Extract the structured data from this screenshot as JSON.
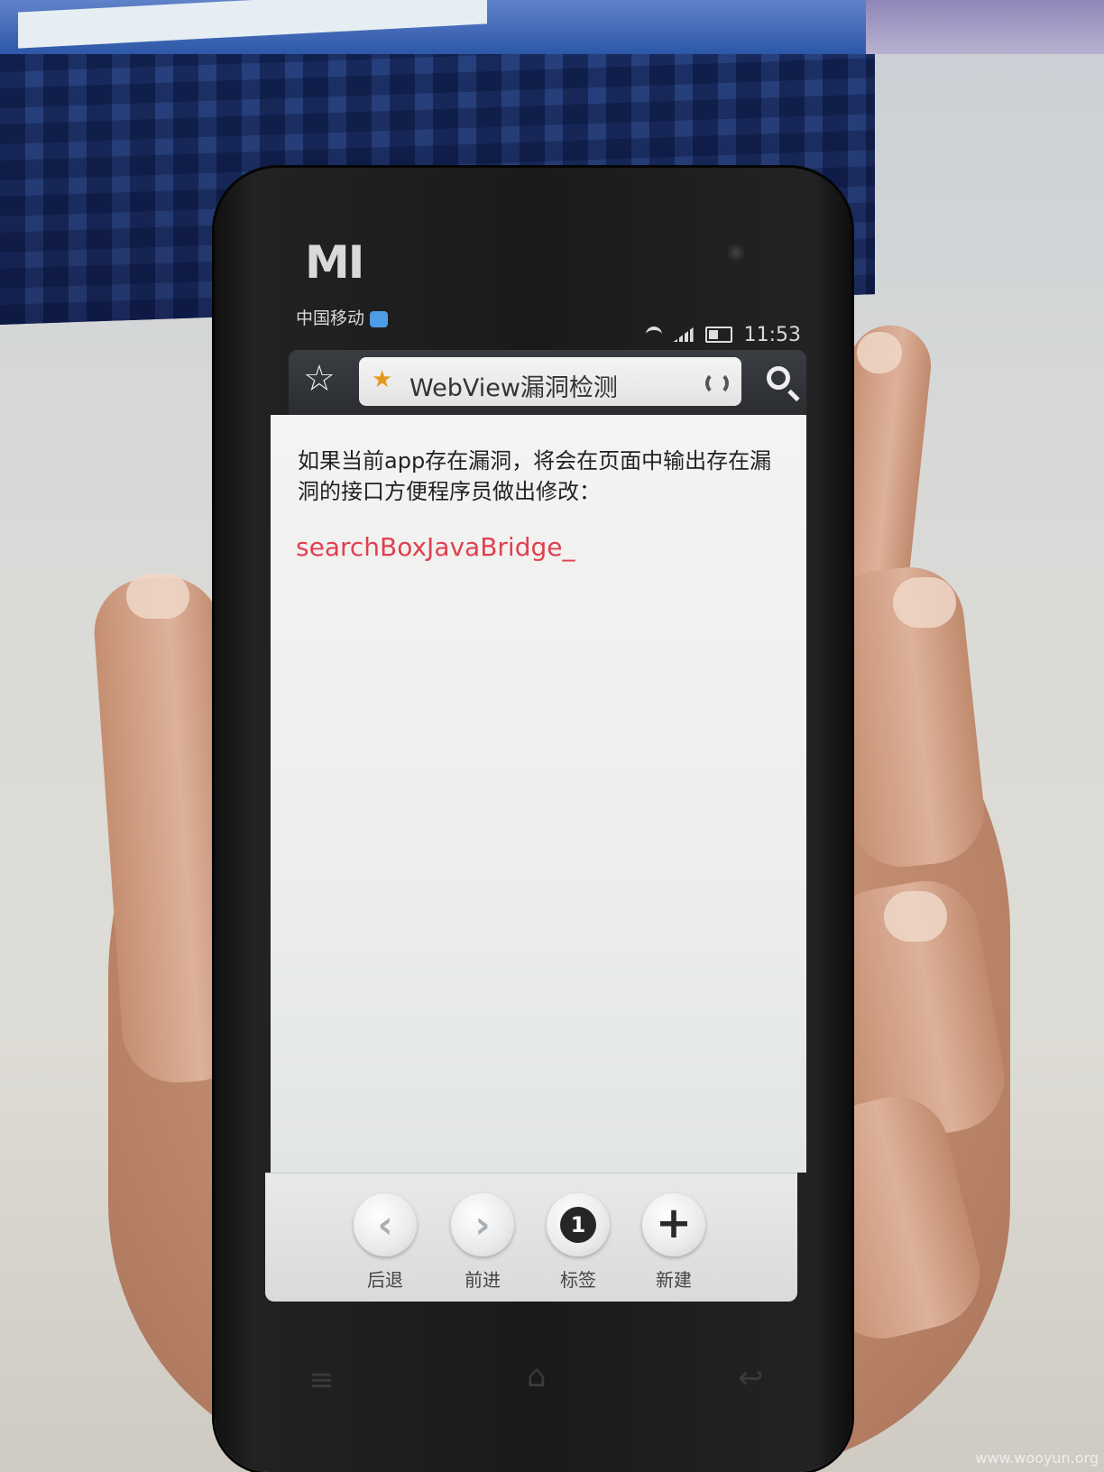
{
  "brand": {
    "logo": "MI"
  },
  "statusbar": {
    "carrier": "中国移动",
    "time": "11:53"
  },
  "browser": {
    "page_title": "WebView漏洞检测"
  },
  "page": {
    "intro": "如果当前app存在漏洞，将会在页面中输出存在漏洞的接口方便程序员做出修改：",
    "vulnerable_interface": "searchBoxJavaBridge_"
  },
  "bottombar": {
    "back_label": "后退",
    "forward_label": "前进",
    "tabs_label": "标签",
    "tab_count": "1",
    "new_label": "新建"
  },
  "watermark": "www.wooyun.org",
  "colors": {
    "interface_text": "#e0404f",
    "url_star": "#e39a1c",
    "toolbar": "#2b2d31"
  },
  "icons": [
    "favorite-star-icon",
    "url-star-icon",
    "refresh-icon",
    "search-icon",
    "back-chevron-icon",
    "forward-chevron-icon",
    "tab-count-icon",
    "plus-icon",
    "menu-key-icon",
    "home-key-icon",
    "back-key-icon"
  ]
}
